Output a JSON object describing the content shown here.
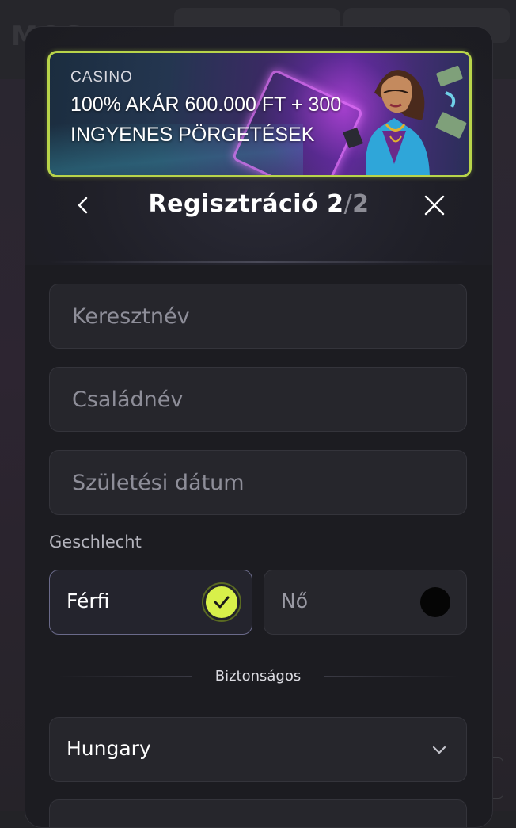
{
  "background": {
    "logo_text": "MOS"
  },
  "banner": {
    "category": "CASINO",
    "promo_text": "100% AKÁR 600.000 FT + 300 INGYENES PÖRGETÉSEK"
  },
  "header": {
    "title": "Regisztráció",
    "step_current": "2",
    "step_separator": "/",
    "step_total": "2",
    "back_icon": "chevron-left-icon",
    "close_icon": "close-icon"
  },
  "form": {
    "first_name": {
      "placeholder": "Keresztnév",
      "value": ""
    },
    "last_name": {
      "placeholder": "Családnév",
      "value": ""
    },
    "birth_date": {
      "placeholder": "Születési dátum",
      "value": ""
    },
    "gender": {
      "label": "Geschlecht",
      "options": [
        {
          "label": "Férfi",
          "selected": true
        },
        {
          "label": "Nő",
          "selected": false
        }
      ]
    },
    "secure_label": "Biztonságos",
    "country": {
      "value": "Hungary",
      "icon": "chevron-down-icon"
    }
  },
  "colors": {
    "accent": "#d8f04a",
    "banner_border": "#b8d44a",
    "modal_bg": "#1c1c21",
    "field_bg": "#26262c"
  }
}
